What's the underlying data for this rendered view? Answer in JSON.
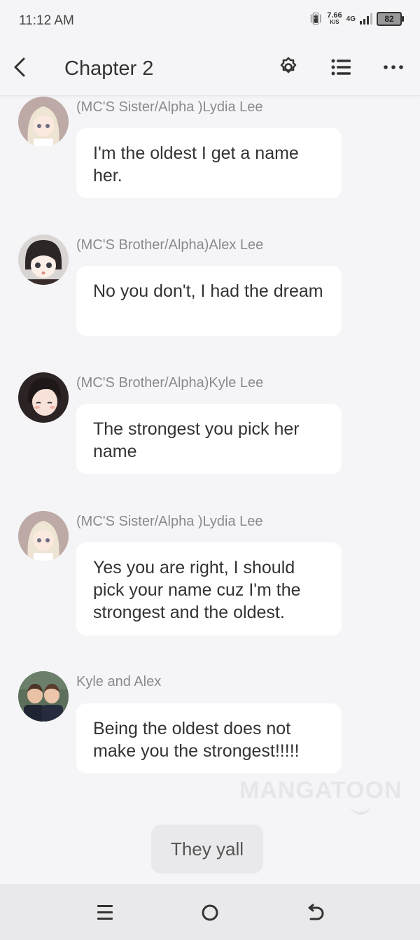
{
  "status_bar": {
    "time": "11:12 AM",
    "net_speed": "7.66",
    "net_speed_unit": "K/S",
    "network": "4G",
    "battery": "82"
  },
  "header": {
    "title": "Chapter 2",
    "icons": [
      "back-icon",
      "gear-icon",
      "list-icon",
      "more-icon"
    ]
  },
  "messages": [
    {
      "name": "(MC'S Sister/Alpha )Lydia Lee",
      "text": "I'm the oldest I get a name her.",
      "avatar": "lydia-avatar"
    },
    {
      "name": "(MC'S Brother/Alpha)Alex Lee",
      "text": "No you don't, I had the dream",
      "avatar": "alex-avatar"
    },
    {
      "name": "(MC'S Brother/Alpha)Kyle Lee",
      "text": "The strongest you pick her name",
      "avatar": "kyle-avatar"
    },
    {
      "name": "(MC'S Sister/Alpha )Lydia Lee",
      "text": "Yes you are right, I should pick your name cuz I'm the strongest and the oldest.",
      "avatar": "lydia-avatar"
    },
    {
      "name": "Kyle and Alex",
      "text": "Being the oldest does not make you the strongest!!!!!",
      "avatar": "kyle-and-alex-avatar"
    }
  ],
  "watermark": "MANGATOON",
  "reply_button": "They yall",
  "nav_bar": {
    "icons": [
      "menu-icon",
      "home-icon",
      "back-icon"
    ]
  }
}
